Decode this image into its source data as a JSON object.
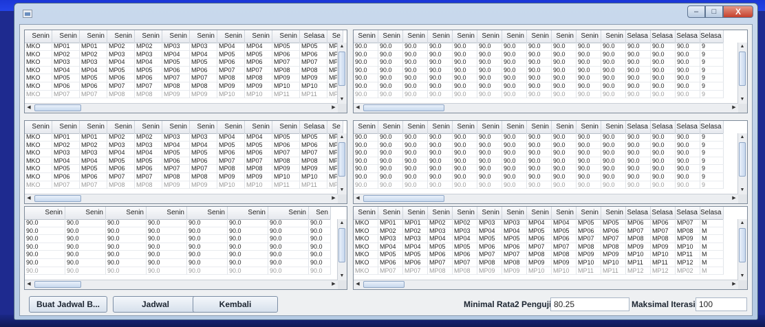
{
  "window": {
    "controls": {
      "minimize": "–",
      "maximize": "□",
      "close": "X"
    }
  },
  "tables": {
    "t1": {
      "headers": [
        "Senin",
        "Senin",
        "Senin",
        "Senin",
        "Senin",
        "Senin",
        "Senin",
        "Senin",
        "Senin",
        "Senin",
        "Selasa",
        "Se"
      ],
      "rows": [
        [
          "MKO",
          "MP01",
          "MP01",
          "MP02",
          "MP02",
          "MP03",
          "MP03",
          "MP04",
          "MP04",
          "MP05",
          "MP05",
          "MP"
        ],
        [
          "MKO",
          "MP02",
          "MP02",
          "MP03",
          "MP03",
          "MP04",
          "MP04",
          "MP05",
          "MP05",
          "MP06",
          "MP06",
          "MP"
        ],
        [
          "MKO",
          "MP03",
          "MP03",
          "MP04",
          "MP04",
          "MP05",
          "MP05",
          "MP06",
          "MP06",
          "MP07",
          "MP07",
          "MP"
        ],
        [
          "MKO",
          "MP04",
          "MP04",
          "MP05",
          "MP05",
          "MP06",
          "MP06",
          "MP07",
          "MP07",
          "MP08",
          "MP08",
          "MP"
        ],
        [
          "MKO",
          "MP05",
          "MP05",
          "MP06",
          "MP06",
          "MP07",
          "MP07",
          "MP08",
          "MP08",
          "MP09",
          "MP09",
          "MP"
        ],
        [
          "MKO",
          "MP06",
          "MP06",
          "MP07",
          "MP07",
          "MP08",
          "MP08",
          "MP09",
          "MP09",
          "MP10",
          "MP10",
          "MP"
        ],
        [
          "MKO",
          "MP07",
          "MP07",
          "MP08",
          "MP08",
          "MP09",
          "MP09",
          "MP10",
          "MP10",
          "MP11",
          "MP11",
          "MP"
        ]
      ]
    },
    "t2": {
      "headers": [
        "Senin",
        "Senin",
        "Senin",
        "Senin",
        "Senin",
        "Senin",
        "Senin",
        "Senin",
        "Senin",
        "Senin",
        "Senin",
        "Selasa",
        "Selasa",
        "Selasa",
        "Selasa"
      ],
      "rows": [
        [
          "90.0",
          "90.0",
          "90.0",
          "90.0",
          "90.0",
          "90.0",
          "90.0",
          "90.0",
          "90.0",
          "90.0",
          "90.0",
          "90.0",
          "90.0",
          "90.0",
          "9"
        ],
        [
          "90.0",
          "90.0",
          "90.0",
          "90.0",
          "90.0",
          "90.0",
          "90.0",
          "90.0",
          "90.0",
          "90.0",
          "90.0",
          "90.0",
          "90.0",
          "90.0",
          "9"
        ],
        [
          "90.0",
          "90.0",
          "90.0",
          "90.0",
          "90.0",
          "90.0",
          "90.0",
          "90.0",
          "90.0",
          "90.0",
          "90.0",
          "90.0",
          "90.0",
          "90.0",
          "9"
        ],
        [
          "90.0",
          "90.0",
          "90.0",
          "90.0",
          "90.0",
          "90.0",
          "90.0",
          "90.0",
          "90.0",
          "90.0",
          "90.0",
          "90.0",
          "90.0",
          "90.0",
          "9"
        ],
        [
          "90.0",
          "90.0",
          "90.0",
          "90.0",
          "90.0",
          "90.0",
          "90.0",
          "90.0",
          "90.0",
          "90.0",
          "90.0",
          "90.0",
          "90.0",
          "90.0",
          "9"
        ],
        [
          "90.0",
          "90.0",
          "90.0",
          "90.0",
          "90.0",
          "90.0",
          "90.0",
          "90.0",
          "90.0",
          "90.0",
          "90.0",
          "90.0",
          "90.0",
          "90.0",
          "9"
        ],
        [
          "90.0",
          "90.0",
          "90.0",
          "90.0",
          "90.0",
          "90.0",
          "90.0",
          "90.0",
          "90.0",
          "90.0",
          "90.0",
          "90.0",
          "90.0",
          "90.0",
          "9"
        ]
      ]
    },
    "t3": {
      "headers": [
        "Senin",
        "Senin",
        "Senin",
        "Senin",
        "Senin",
        "Senin",
        "Senin",
        "Senin",
        "Senin",
        "Senin",
        "Selasa",
        "Se"
      ],
      "rows": [
        [
          "MKO",
          "MP01",
          "MP01",
          "MP02",
          "MP02",
          "MP03",
          "MP03",
          "MP04",
          "MP04",
          "MP05",
          "MP05",
          "MP"
        ],
        [
          "MKO",
          "MP02",
          "MP02",
          "MP03",
          "MP03",
          "MP04",
          "MP04",
          "MP05",
          "MP05",
          "MP06",
          "MP06",
          "MP"
        ],
        [
          "MKO",
          "MP03",
          "MP03",
          "MP04",
          "MP04",
          "MP05",
          "MP05",
          "MP06",
          "MP06",
          "MP07",
          "MP07",
          "MP"
        ],
        [
          "MKO",
          "MP04",
          "MP04",
          "MP05",
          "MP05",
          "MP06",
          "MP06",
          "MP07",
          "MP07",
          "MP08",
          "MP08",
          "MP"
        ],
        [
          "MKO",
          "MP05",
          "MP05",
          "MP06",
          "MP06",
          "MP07",
          "MP07",
          "MP08",
          "MP08",
          "MP09",
          "MP09",
          "MP"
        ],
        [
          "MKO",
          "MP06",
          "MP06",
          "MP07",
          "MP07",
          "MP08",
          "MP08",
          "MP09",
          "MP09",
          "MP10",
          "MP10",
          "MP"
        ],
        [
          "MKO",
          "MP07",
          "MP07",
          "MP08",
          "MP08",
          "MP09",
          "MP09",
          "MP10",
          "MP10",
          "MP11",
          "MP11",
          "MP"
        ]
      ]
    },
    "t4": {
      "headers": [
        "Senin",
        "Senin",
        "Senin",
        "Senin",
        "Senin",
        "Senin",
        "Senin",
        "Senin",
        "Senin",
        "Senin",
        "Senin",
        "Selasa",
        "Selasa",
        "Selasa",
        "Selasa"
      ],
      "rows": [
        [
          "90.0",
          "90.0",
          "90.0",
          "90.0",
          "90.0",
          "90.0",
          "90.0",
          "90.0",
          "90.0",
          "90.0",
          "90.0",
          "90.0",
          "90.0",
          "90.0",
          "9"
        ],
        [
          "90.0",
          "90.0",
          "90.0",
          "90.0",
          "90.0",
          "90.0",
          "90.0",
          "90.0",
          "90.0",
          "90.0",
          "90.0",
          "90.0",
          "90.0",
          "90.0",
          "9"
        ],
        [
          "90.0",
          "90.0",
          "90.0",
          "90.0",
          "90.0",
          "90.0",
          "90.0",
          "90.0",
          "90.0",
          "90.0",
          "90.0",
          "90.0",
          "90.0",
          "90.0",
          "9"
        ],
        [
          "90.0",
          "90.0",
          "90.0",
          "90.0",
          "90.0",
          "90.0",
          "90.0",
          "90.0",
          "90.0",
          "90.0",
          "90.0",
          "90.0",
          "90.0",
          "90.0",
          "9"
        ],
        [
          "90.0",
          "90.0",
          "90.0",
          "90.0",
          "90.0",
          "90.0",
          "90.0",
          "90.0",
          "90.0",
          "90.0",
          "90.0",
          "90.0",
          "90.0",
          "90.0",
          "9"
        ],
        [
          "90.0",
          "90.0",
          "90.0",
          "90.0",
          "90.0",
          "90.0",
          "90.0",
          "90.0",
          "90.0",
          "90.0",
          "90.0",
          "90.0",
          "90.0",
          "90.0",
          "9"
        ],
        [
          "90.0",
          "90.0",
          "90.0",
          "90.0",
          "90.0",
          "90.0",
          "90.0",
          "90.0",
          "90.0",
          "90.0",
          "90.0",
          "90.0",
          "90.0",
          "90.0",
          "9"
        ]
      ]
    },
    "t5": {
      "headers": [
        "Senin",
        "Senin",
        "Senin",
        "Senin",
        "Senin",
        "Senin",
        "Senin",
        "Sen"
      ],
      "rows": [
        [
          "90.0",
          "90.0",
          "90.0",
          "90.0",
          "90.0",
          "90.0",
          "90.0",
          "90.0"
        ],
        [
          "90.0",
          "90.0",
          "90.0",
          "90.0",
          "90.0",
          "90.0",
          "90.0",
          "90.0"
        ],
        [
          "90.0",
          "90.0",
          "90.0",
          "90.0",
          "90.0",
          "90.0",
          "90.0",
          "90.0"
        ],
        [
          "90.0",
          "90.0",
          "90.0",
          "90.0",
          "90.0",
          "90.0",
          "90.0",
          "90.0"
        ],
        [
          "90.0",
          "90.0",
          "90.0",
          "90.0",
          "90.0",
          "90.0",
          "90.0",
          "90.0"
        ],
        [
          "90.0",
          "90.0",
          "90.0",
          "90.0",
          "90.0",
          "90.0",
          "90.0",
          "90.0"
        ],
        [
          "90.0",
          "90.0",
          "90.0",
          "90.0",
          "90.0",
          "90.0",
          "90.0",
          "90.0"
        ]
      ]
    },
    "t6": {
      "headers": [
        "Senin",
        "Senin",
        "Senin",
        "Senin",
        "Senin",
        "Senin",
        "Senin",
        "Senin",
        "Senin",
        "Senin",
        "Senin",
        "Selasa",
        "Selasa",
        "Selasa",
        "Selasa"
      ],
      "rows": [
        [
          "MKO",
          "MP01",
          "MP01",
          "MP02",
          "MP02",
          "MP03",
          "MP03",
          "MP04",
          "MP04",
          "MP05",
          "MP05",
          "MP06",
          "MP06",
          "MP07",
          "M"
        ],
        [
          "MKO",
          "MP02",
          "MP02",
          "MP03",
          "MP03",
          "MP04",
          "MP04",
          "MP05",
          "MP05",
          "MP06",
          "MP06",
          "MP07",
          "MP07",
          "MP08",
          "M"
        ],
        [
          "MKO",
          "MP03",
          "MP03",
          "MP04",
          "MP04",
          "MP05",
          "MP05",
          "MP06",
          "MP06",
          "MP07",
          "MP07",
          "MP08",
          "MP08",
          "MP09",
          "M"
        ],
        [
          "MKO",
          "MP04",
          "MP04",
          "MP05",
          "MP05",
          "MP06",
          "MP06",
          "MP07",
          "MP07",
          "MP08",
          "MP08",
          "MP09",
          "MP09",
          "MP10",
          "M"
        ],
        [
          "MKO",
          "MP05",
          "MP05",
          "MP06",
          "MP06",
          "MP07",
          "MP07",
          "MP08",
          "MP08",
          "MP09",
          "MP09",
          "MP10",
          "MP10",
          "MP11",
          "M"
        ],
        [
          "MKO",
          "MP06",
          "MP06",
          "MP07",
          "MP07",
          "MP08",
          "MP08",
          "MP09",
          "MP09",
          "MP10",
          "MP10",
          "MP11",
          "MP11",
          "MP12",
          "M"
        ],
        [
          "MKO",
          "MP07",
          "MP07",
          "MP08",
          "MP08",
          "MP09",
          "MP09",
          "MP10",
          "MP10",
          "MP11",
          "MP11",
          "MP12",
          "MP12",
          "MP02",
          "M"
        ]
      ]
    }
  },
  "buttons": {
    "buat_jadwal": "Buat Jadwal B...",
    "jadwal": "Jadwal",
    "kembali": "Kembali"
  },
  "fields": {
    "min_rata_label": "Minimal Rata2 Pengujian",
    "min_rata_value": "80.25",
    "max_iterasi_label": "Maksimal Iterasi",
    "max_iterasi_value": "100"
  },
  "scroll": {
    "arrow_up": "▲",
    "arrow_down": "▼",
    "arrow_left": "◀",
    "arrow_right": "▶"
  }
}
